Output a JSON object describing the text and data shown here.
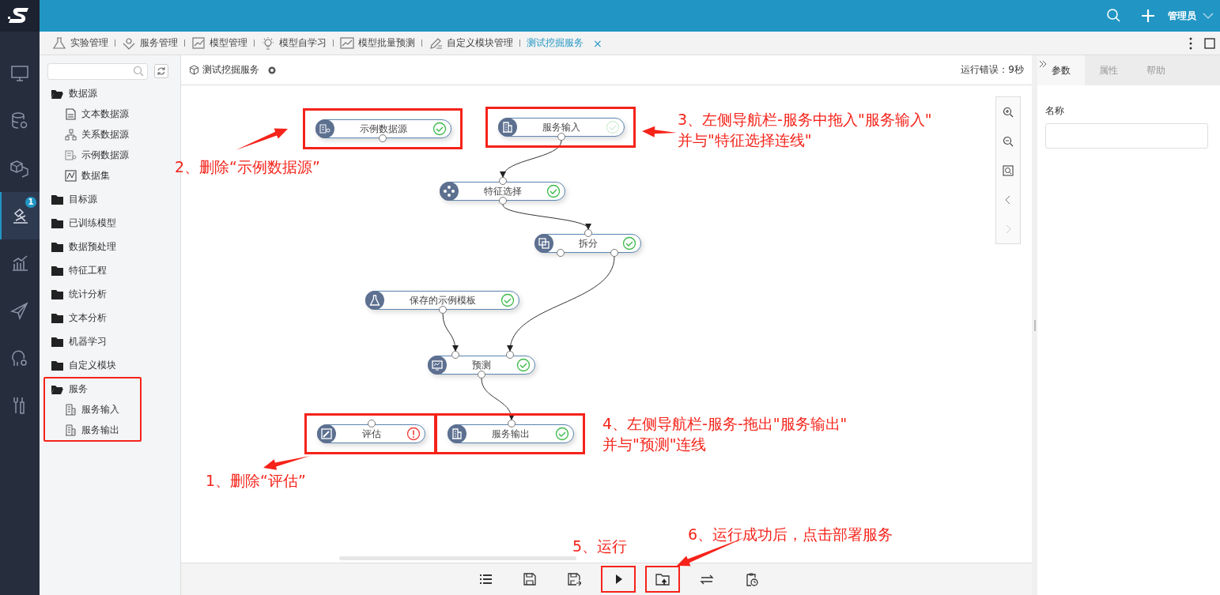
{
  "header": {
    "user": "管理员"
  },
  "rail": [
    {
      "selected": false
    },
    {
      "selected": false
    },
    {
      "selected": false
    },
    {
      "selected": true,
      "badge": "1"
    },
    {
      "selected": false
    },
    {
      "selected": false
    },
    {
      "selected": false
    },
    {
      "selected": false
    }
  ],
  "tabs": [
    {
      "label": "实验管理",
      "selected": false
    },
    {
      "label": "服务管理",
      "selected": false
    },
    {
      "label": "模型管理",
      "selected": false
    },
    {
      "label": "模型自学习",
      "selected": false
    },
    {
      "label": "模型批量预测",
      "selected": false
    },
    {
      "label": "自定义模块管理",
      "selected": false
    },
    {
      "label": "测试挖掘服务",
      "selected": true,
      "close": "×"
    }
  ],
  "sidebar": {
    "items": [
      {
        "label": "数据源",
        "expanded": true,
        "highlighted": false,
        "children": [
          {
            "label": "文本数据源",
            "kind": "text"
          },
          {
            "label": "关系数据源",
            "kind": "relation"
          },
          {
            "label": "示例数据源",
            "kind": "sample"
          },
          {
            "label": "数据集",
            "kind": "dataset"
          }
        ]
      },
      {
        "label": "目标源",
        "expanded": false,
        "highlighted": false
      },
      {
        "label": "已训练模型",
        "expanded": false,
        "highlighted": false
      },
      {
        "label": "数据预处理",
        "expanded": false,
        "highlighted": false
      },
      {
        "label": "特征工程",
        "expanded": false,
        "highlighted": false
      },
      {
        "label": "统计分析",
        "expanded": false,
        "highlighted": false
      },
      {
        "label": "文本分析",
        "expanded": false,
        "highlighted": false
      },
      {
        "label": "机器学习",
        "expanded": false,
        "highlighted": false
      },
      {
        "label": "自定义模块",
        "expanded": false,
        "highlighted": false
      },
      {
        "label": "服务",
        "expanded": true,
        "highlighted": true,
        "children": [
          {
            "label": "服务输入",
            "kind": "service"
          },
          {
            "label": "服务输出",
            "kind": "service"
          }
        ]
      }
    ]
  },
  "workspace": {
    "title": "测试挖掘服务",
    "status": "运行错误：9秒"
  },
  "nodes": [
    {
      "label": "示例数据源",
      "kind": "done",
      "highlighted": true
    },
    {
      "label": "服务输入",
      "kind": "pending",
      "highlighted": true
    },
    {
      "label": "特征选择",
      "kind": "done",
      "highlighted": false
    },
    {
      "label": "拆分",
      "kind": "done",
      "highlighted": false
    },
    {
      "label": "保存的示例模板",
      "kind": "done",
      "highlighted": false
    },
    {
      "label": "预测",
      "kind": "done",
      "highlighted": false
    },
    {
      "label": "评估",
      "kind": "error",
      "highlighted": true
    },
    {
      "label": "服务输出",
      "kind": "done",
      "highlighted": true
    }
  ],
  "toolbar": [
    {
      "highlighted": false
    },
    {
      "highlighted": false
    },
    {
      "highlighted": false
    },
    {
      "highlighted": true
    },
    {
      "highlighted": true
    },
    {
      "highlighted": false
    },
    {
      "highlighted": false
    }
  ],
  "annotations": [
    {
      "lines": [
        "3、左侧导航栏-服务中拖入\"服务输入\"",
        "并与\"特征选择连线\""
      ]
    },
    {
      "lines": [
        "2、删除“示例数据源”"
      ]
    },
    {
      "lines": [
        "4、左侧导航栏-服务-拖出\"服务输出\"",
        "并与\"预测\"连线"
      ]
    },
    {
      "lines": [
        "1、删除“评估”"
      ]
    },
    {
      "lines": [
        "6、运行成功后，点击部署服务"
      ]
    },
    {
      "lines": [
        "5、运行"
      ]
    }
  ],
  "panel": {
    "tabs": [
      {
        "label": "参数",
        "selected": true
      },
      {
        "label": "属性",
        "selected": false
      },
      {
        "label": "帮助",
        "selected": false
      }
    ],
    "field_label": "名称"
  }
}
